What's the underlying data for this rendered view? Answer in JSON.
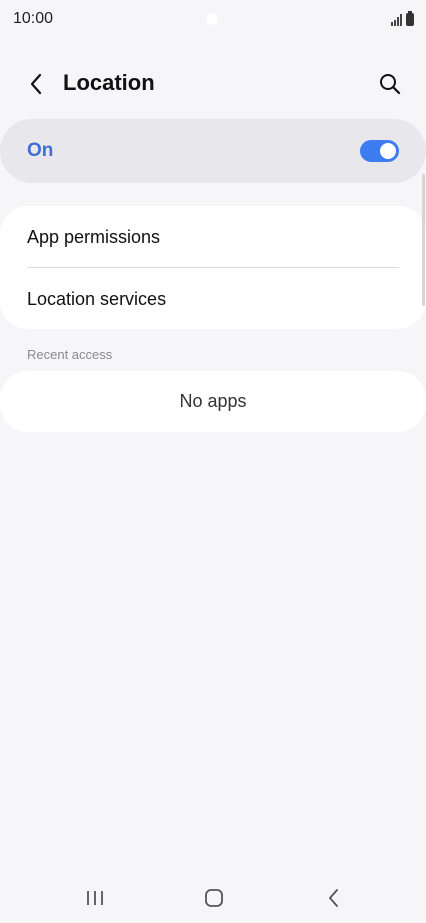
{
  "status_bar": {
    "time": "10:00"
  },
  "header": {
    "title": "Location",
    "back_icon": "chevron-left-icon",
    "search_icon": "search-icon"
  },
  "location_toggle": {
    "label": "On",
    "state": "on",
    "accent_color": "#3e6fd6"
  },
  "menu": {
    "items": [
      {
        "label": "App permissions"
      },
      {
        "label": "Location services"
      }
    ]
  },
  "recent_access": {
    "header": "Recent access",
    "empty_text": "No apps"
  },
  "nav_bar": {
    "recents_icon": "recents-icon",
    "home_icon": "home-icon",
    "back_icon": "back-icon"
  }
}
